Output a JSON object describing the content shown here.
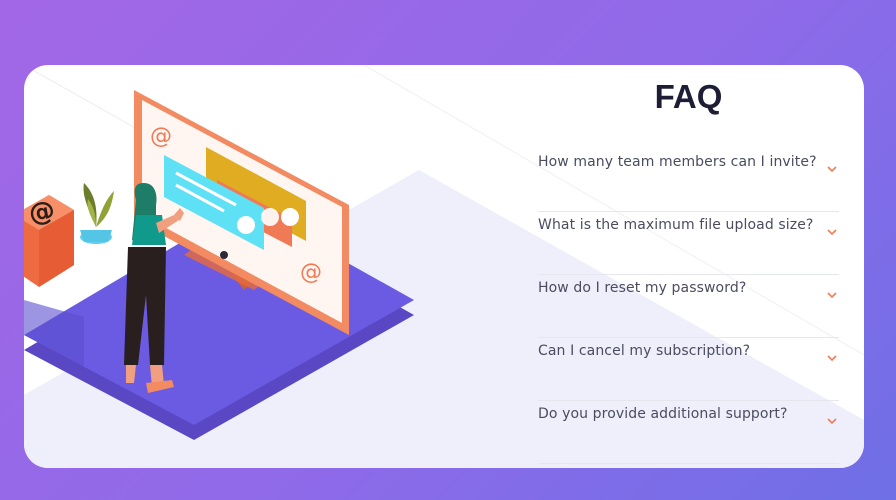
{
  "faq": {
    "title": "FAQ",
    "items": [
      {
        "question": "How many team members can I invite?"
      },
      {
        "question": "What is the maximum file upload size?"
      },
      {
        "question": "How do I reset my password?"
      },
      {
        "question": "Can I cancel my subscription?"
      },
      {
        "question": "Do you provide additional support?"
      }
    ]
  },
  "colors": {
    "page_background": "#9a68e8",
    "card": "#ffffff",
    "accent_chevron": "#f47b56",
    "heading": "#1d1e35",
    "question_text": "#4b4c5f"
  },
  "icons": [
    "chevron-down-icon",
    "at-sign-icon"
  ]
}
